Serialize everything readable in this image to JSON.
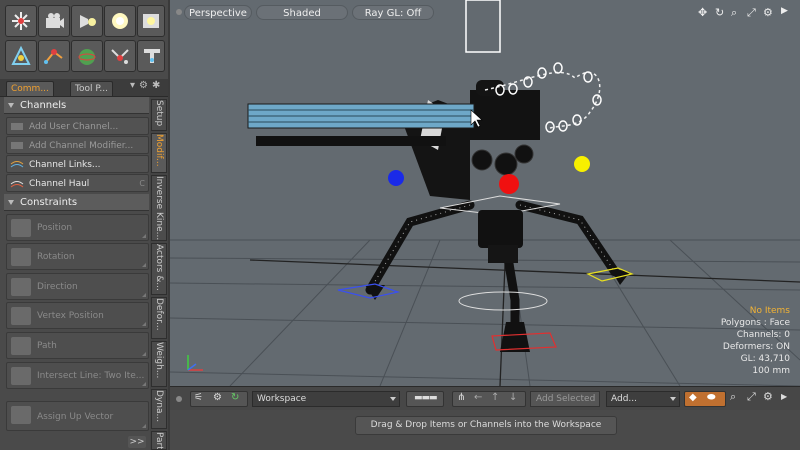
{
  "left_panel": {
    "tabs": [
      {
        "label": "Comm..."
      },
      {
        "label": "Tool P..."
      }
    ],
    "sections": {
      "channels": "Channels",
      "constraints": "Constraints"
    },
    "channel_items": [
      {
        "label": "Add User Channel...",
        "key": ""
      },
      {
        "label": "Add Channel Modifier...",
        "key": ""
      },
      {
        "label": "Channel Links...",
        "key": ""
      },
      {
        "label": "Channel Haul",
        "key": "C"
      }
    ],
    "constraint_items": [
      {
        "label": "Position"
      },
      {
        "label": "Rotation"
      },
      {
        "label": "Direction"
      },
      {
        "label": "Vertex Position"
      },
      {
        "label": "Path"
      },
      {
        "label": "Intersect Line: Two Ite..."
      },
      {
        "label": "Assign Up Vector"
      }
    ],
    "vertical_tabs": [
      {
        "label": "Setup"
      },
      {
        "label": "Modif..."
      },
      {
        "label": "Inverse Kine..."
      },
      {
        "label": "Actors &..."
      },
      {
        "label": "Defor..."
      },
      {
        "label": "Weigh..."
      },
      {
        "label": "Dyna..."
      },
      {
        "label": "Parti..."
      }
    ],
    "expand_label": ">>"
  },
  "viewport": {
    "view_mode": "Perspective",
    "shading": "Shaded",
    "raygl": "Ray GL: Off",
    "hud": {
      "selection": "No Items",
      "polygons": "Polygons : Face",
      "channels": "Channels: 0",
      "deformers": "Deformers: ON",
      "gl": "GL: 43,710",
      "unit": "100 mm"
    }
  },
  "workspace": {
    "select_value": "Workspace",
    "add_selected": "Add Selected",
    "add_menu": "Add...",
    "drop_hint": "Drag & Drop Items or Channels into the Workspace"
  },
  "colors": {
    "accent_orange": "#f0a030",
    "viewport_bg": "#636a70",
    "hud_highlight": "#f2b335"
  }
}
